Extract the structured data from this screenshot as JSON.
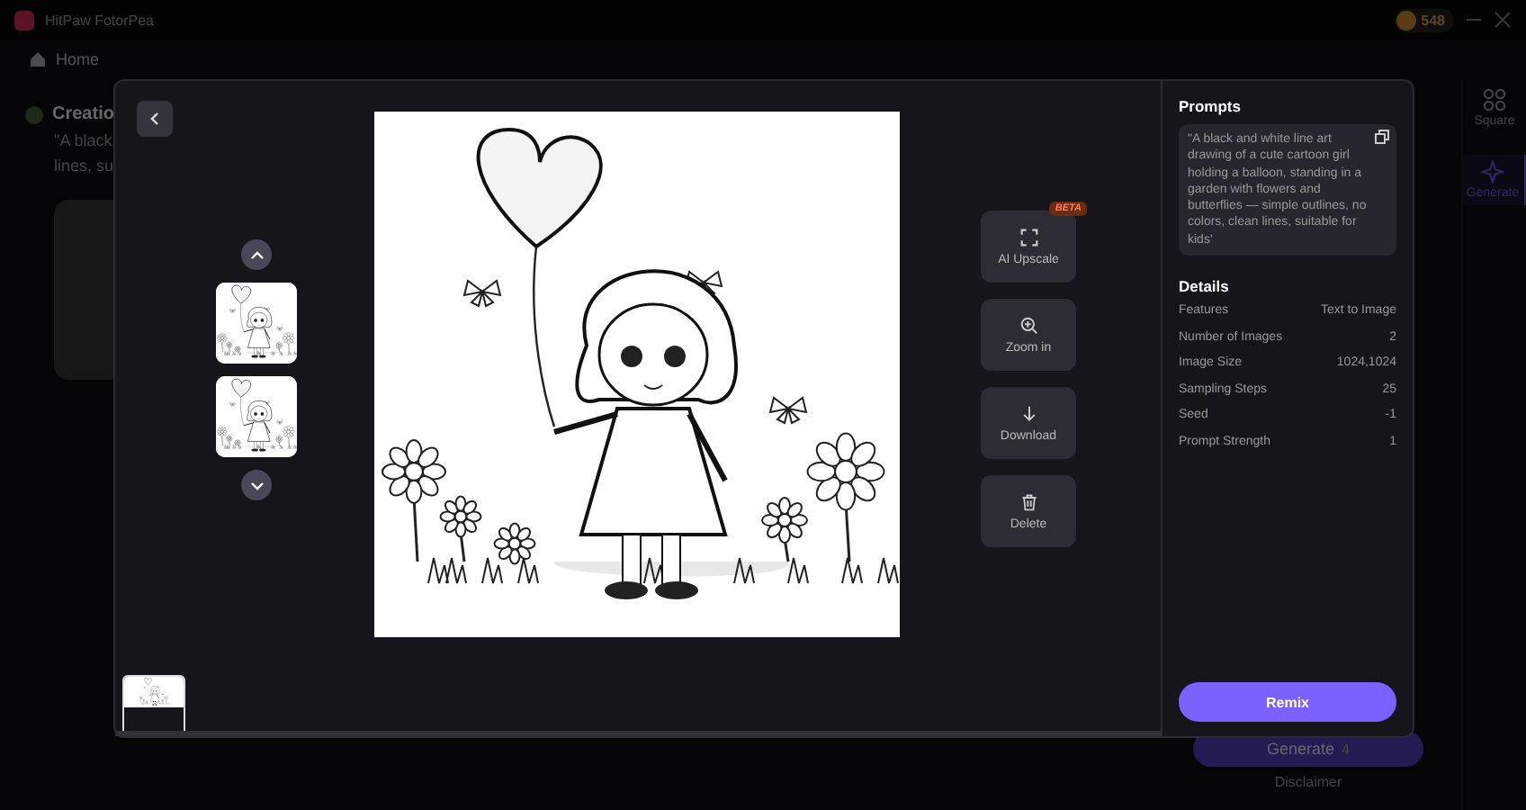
{
  "app": {
    "title": "HitPaw FotorPea",
    "coins": "548",
    "nav": "Home",
    "side_tools": [
      {
        "label": "Square",
        "kind": "square",
        "selected": false
      },
      {
        "label": "Generate",
        "kind": "generate",
        "selected": true
      }
    ],
    "creation_title": "Creatio",
    "creation_text": [
      "\"A black",
      "lines, su"
    ],
    "generate": {
      "label": "Generate",
      "cost": "4"
    },
    "disclaimer": "Disclaimer"
  },
  "viewer": {
    "tools": [
      {
        "label": "AI Upscale",
        "kind": "upscale",
        "badge": "BETA"
      },
      {
        "label": "Zoom in",
        "kind": "zoom"
      },
      {
        "label": "Download",
        "kind": "download"
      },
      {
        "label": "Delete",
        "kind": "delete"
      }
    ],
    "prompts_title": "Prompts",
    "prompt": "\"A black and white line art drawing of a cute cartoon girl holding a balloon, standing in a garden with flowers and butterflies — simple outlines, no colors, clean lines, suitable for kids'",
    "details_title": "Details",
    "details": [
      {
        "label": "Features",
        "value": "Text to Image"
      },
      {
        "label": "Number of Images",
        "value": "2"
      },
      {
        "label": "Image Size",
        "value": "1024,1024"
      },
      {
        "label": "Sampling Steps",
        "value": "25"
      },
      {
        "label": "Seed",
        "value": "-1"
      },
      {
        "label": "Prompt Strength",
        "value": "1"
      }
    ],
    "remix": "Remix"
  }
}
